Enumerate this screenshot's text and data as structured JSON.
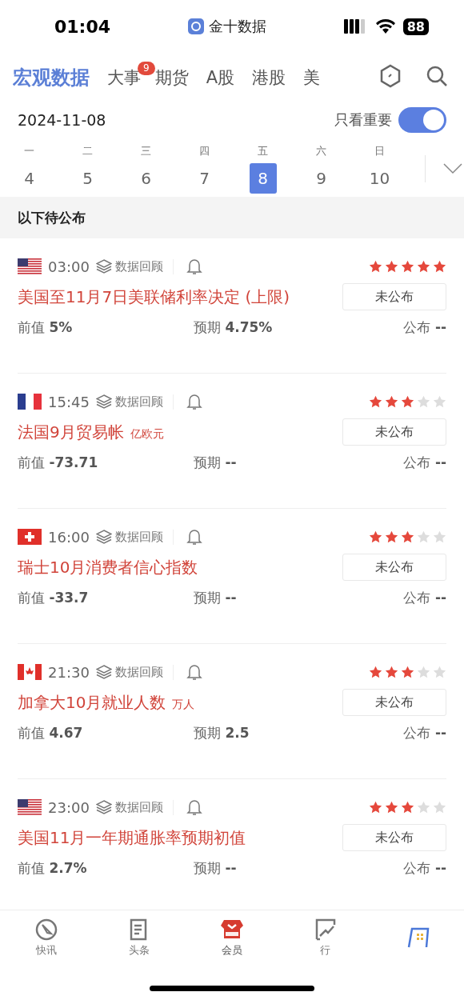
{
  "status_bar": {
    "time": "01:04",
    "app": "金十数据",
    "battery": "88"
  },
  "tabs": [
    {
      "label": "宏观数据",
      "selected": true
    },
    {
      "label": "大事",
      "selected": false,
      "badge": "9"
    },
    {
      "label": "期货",
      "selected": false
    },
    {
      "label": "A股",
      "selected": false
    },
    {
      "label": "港股",
      "selected": false
    },
    {
      "label": "美",
      "selected": false
    }
  ],
  "date": "2024-11-08",
  "important_toggle": {
    "label": "只看重要",
    "on": true
  },
  "week": [
    {
      "weekday": "一",
      "day": "4",
      "selected": false
    },
    {
      "weekday": "二",
      "day": "5",
      "selected": false
    },
    {
      "weekday": "三",
      "day": "6",
      "selected": false
    },
    {
      "weekday": "四",
      "day": "7",
      "selected": false
    },
    {
      "weekday": "五",
      "day": "8",
      "selected": true
    },
    {
      "weekday": "六",
      "day": "9",
      "selected": false
    },
    {
      "weekday": "日",
      "day": "10",
      "selected": false
    }
  ],
  "section_title": "以下待公布",
  "events": [
    {
      "kind": "us",
      "time": "03:00",
      "review": "数据回顾",
      "stars": 5,
      "title": "美国至11月7日美联储利率决定 (上限)",
      "status": "未公布",
      "previous": {
        "label": "前值",
        "value": "5%"
      },
      "forecast": {
        "label": "预期",
        "value": "4.75%"
      },
      "actual": {
        "label": "公布",
        "value": "--"
      }
    },
    {
      "kind": "fr",
      "time": "15:45",
      "review": "数据回顾",
      "stars": 3,
      "title": "法国9月贸易帐",
      "unit": "亿欧元",
      "status": "未公布",
      "previous": {
        "label": "前值",
        "value": "-73.71"
      },
      "forecast": {
        "label": "预期",
        "value": "--"
      },
      "actual": {
        "label": "公布",
        "value": "--"
      }
    },
    {
      "kind": "ch",
      "time": "16:00",
      "review": "数据回顾",
      "stars": 3,
      "title": "瑞士10月消费者信心指数",
      "status": "未公布",
      "previous": {
        "label": "前值",
        "value": "-33.7"
      },
      "forecast": {
        "label": "预期",
        "value": "--"
      },
      "actual": {
        "label": "公布",
        "value": "--"
      }
    },
    {
      "kind": "ca",
      "time": "21:30",
      "review": "数据回顾",
      "stars": 3,
      "title": "加拿大10月就业人数",
      "unit": "万人",
      "status": "未公布",
      "previous": {
        "label": "前值",
        "value": "4.67"
      },
      "forecast": {
        "label": "预期",
        "value": "2.5"
      },
      "actual": {
        "label": "公布",
        "value": "--"
      }
    },
    {
      "kind": "us",
      "time": "23:00",
      "review": "数据回顾",
      "stars": 3,
      "title": "美国11月一年期通胀率预期初值",
      "status": "未公布",
      "previous": {
        "label": "前值",
        "value": "2.7%"
      },
      "forecast": {
        "label": "预期",
        "value": "--"
      },
      "actual": {
        "label": "公布",
        "value": "--"
      }
    }
  ],
  "bottom_nav": [
    {
      "kind": "flash",
      "label": "快讯",
      "selected": false
    },
    {
      "kind": "news",
      "label": "头条",
      "selected": false
    },
    {
      "kind": "vip",
      "label": "会员",
      "selected": true
    },
    {
      "kind": "chart",
      "label": "行",
      "selected": false
    },
    {
      "kind": "data"
    }
  ]
}
